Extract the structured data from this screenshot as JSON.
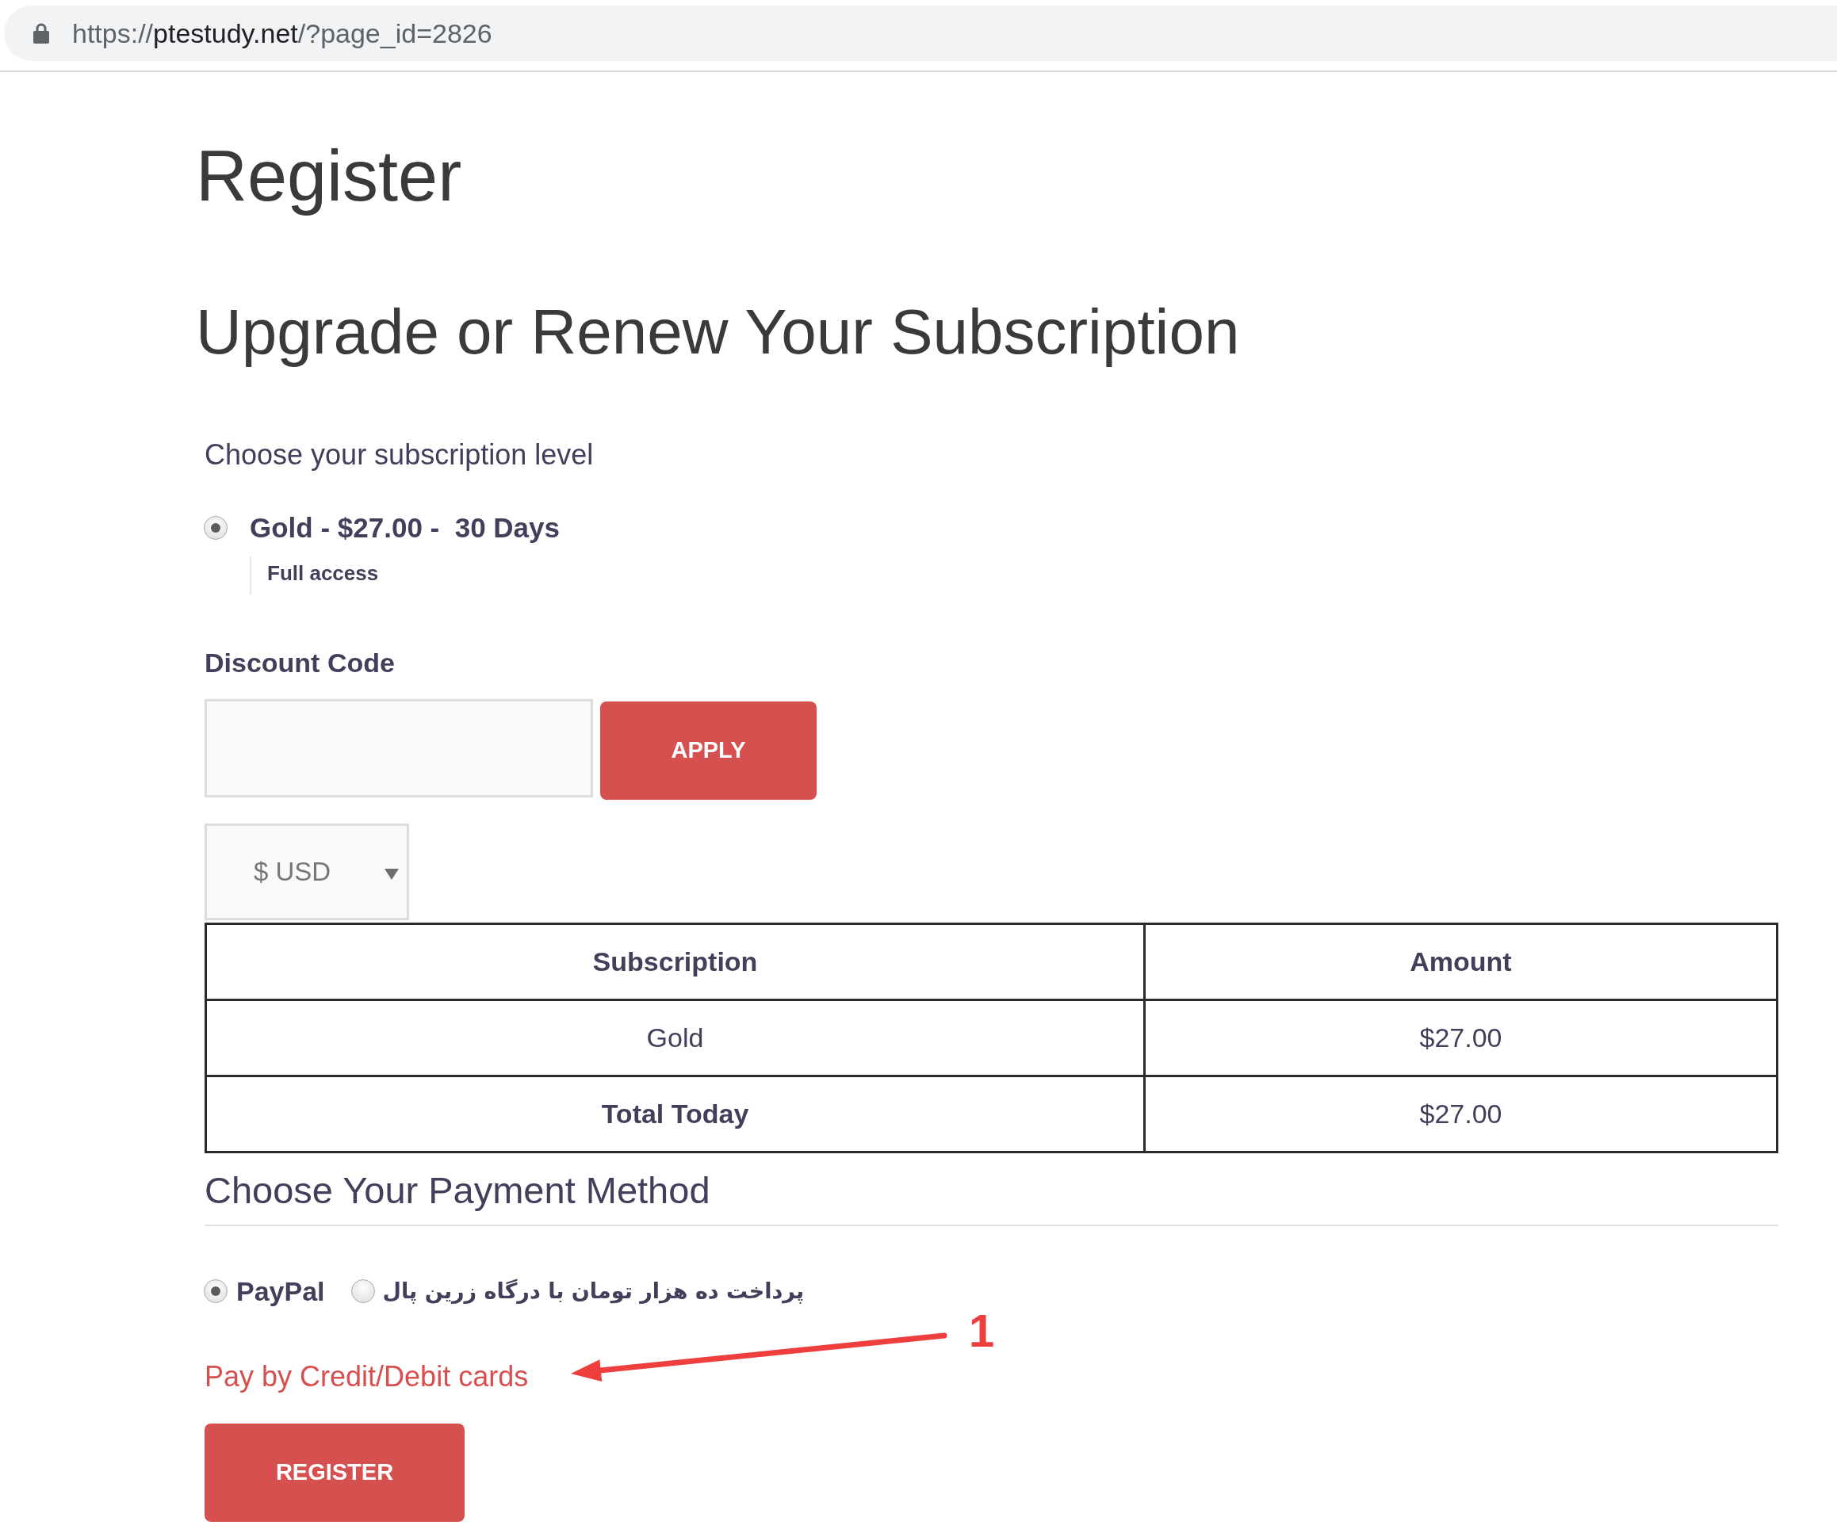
{
  "address_bar": {
    "url": {
      "scheme": "https://",
      "domain": "ptestudy.net",
      "path": "/?page_id=2826"
    }
  },
  "page_title": "Register",
  "section_title": "Upgrade or Renew Your Subscription",
  "subscription": {
    "prompt": "Choose your subscription level",
    "levels": [
      {
        "label": "Gold - $27.00 -  30 Days",
        "description": "Full access",
        "selected": true
      }
    ]
  },
  "discount": {
    "label": "Discount Code",
    "button": "APPLY"
  },
  "currency_select": {
    "value": "$ USD"
  },
  "order_table": {
    "columns": [
      "Subscription",
      "Amount"
    ],
    "rows": [
      {
        "kind": "item",
        "cells": [
          "Gold",
          "$27.00"
        ]
      },
      {
        "kind": "total",
        "cells": [
          "Total Today",
          "$27.00"
        ]
      }
    ]
  },
  "payment": {
    "title": "Choose Your Payment Method",
    "methods": [
      {
        "label": "PayPal",
        "selected": true
      },
      {
        "label": "پرداخت ده هزار تومان با درگاه زرین پال",
        "selected": false
      }
    ],
    "card_link": "Pay by Credit/Debit cards"
  },
  "register_button": "REGISTER",
  "annotation": {
    "label": "1"
  }
}
